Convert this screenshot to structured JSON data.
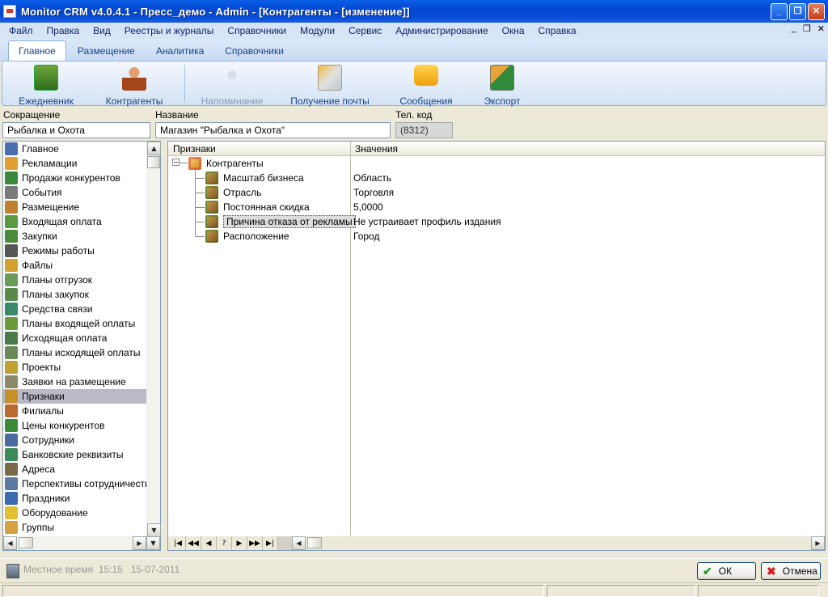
{
  "window": {
    "title": "Monitor CRM v4.0.4.1 - Пресс_демо - Admin - [Контрагенты - [изменение]]"
  },
  "menu": {
    "items": [
      "Файл",
      "Правка",
      "Вид",
      "Реестры и журналы",
      "Справочники",
      "Модули",
      "Сервис",
      "Администрирование",
      "Окна",
      "Справка"
    ]
  },
  "ribbon": {
    "tabs": [
      "Главное",
      "Размещение",
      "Аналитика",
      "Справочники"
    ],
    "active_tab": "Главное",
    "buttons": [
      {
        "label": "Ежедневник",
        "icon": "diary-icon",
        "enabled": true
      },
      {
        "label": "Контрагенты",
        "icon": "person-icon",
        "enabled": true
      },
      {
        "label": "Напоминание",
        "icon": "reminder-bulb-icon",
        "enabled": false
      },
      {
        "label": "Получение почты",
        "icon": "mail-receive-icon",
        "enabled": true
      },
      {
        "label": "Сообщения",
        "icon": "message-bubble-icon",
        "enabled": true
      },
      {
        "label": "Экспорт",
        "icon": "excel-export-icon",
        "enabled": true
      }
    ]
  },
  "form": {
    "short_label": "Сокращение",
    "short_value": "Рыбалка и Охота",
    "name_label": "Название",
    "name_value": "Магазин \"Рыбалка и Охота\"",
    "phone_label": "Тел. код",
    "phone_value": "(8312)"
  },
  "left_list": {
    "items": [
      "Главное",
      "Рекламации",
      "Продажи конкурентов",
      "События",
      "Размещение",
      "Входящая оплата",
      "Закупки",
      "Режимы работы",
      "Файлы",
      "Планы отгрузок",
      "Планы закупок",
      "Средства связи",
      "Планы входящей оплаты",
      "Исходящая оплата",
      "Планы исходящей оплаты",
      "Проекты",
      "Заявки на размещение",
      "Признаки",
      "Филиалы",
      "Цены конкурентов",
      "Сотрудники",
      "Банковские реквизиты",
      "Адреса",
      "Перспективы сотрудничества",
      "Праздники",
      "Оборудование",
      "Группы"
    ],
    "selected": "Признаки"
  },
  "grid": {
    "col_attr": "Признаки",
    "col_value": "Значения",
    "root": "Контрагенты",
    "rows": [
      {
        "attr": "Масштаб бизнеса",
        "value": "Область"
      },
      {
        "attr": "Отрасль",
        "value": "Торговля"
      },
      {
        "attr": "Постоянная скидка",
        "value": "5,0000"
      },
      {
        "attr": "Причина отказа от рекламы",
        "value": "Не устраивает профиль издания"
      },
      {
        "attr": "Расположение",
        "value": "Город"
      }
    ],
    "nav": [
      "|◀",
      "◀◀",
      "◀",
      "?",
      "▶",
      "▶▶",
      "▶|"
    ]
  },
  "footer": {
    "time_label": "Местное время",
    "time": "15:15",
    "date": "15-07-2011",
    "ok_label": "ОК",
    "cancel_label": "Отмена"
  },
  "colors": {
    "titlebar": "#0a5ee6",
    "menubar": "#d7e4f6",
    "ribbon": "#dce8f8",
    "selection": "#b9b9c8"
  }
}
